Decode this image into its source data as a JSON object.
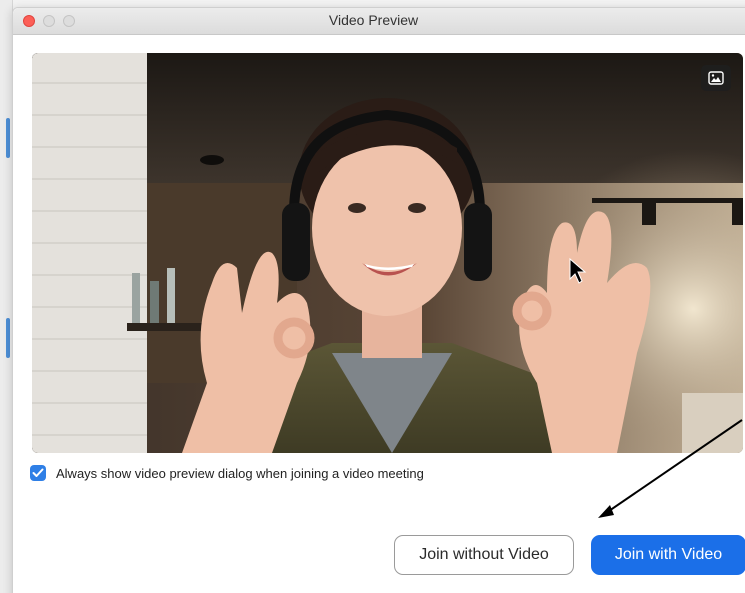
{
  "window": {
    "title": "Video Preview"
  },
  "video": {
    "icon": "picture-in-picture-icon",
    "content": "camera-preview"
  },
  "options": {
    "always_show_preview_label": "Always show video preview dialog when joining a video meeting",
    "always_show_preview_checked": true
  },
  "buttons": {
    "join_without_video": "Join without Video",
    "join_with_video": "Join with Video"
  },
  "colors": {
    "primary_button": "#1b6fe8",
    "checkbox": "#2f7fe6",
    "close_button": "#fc5f57"
  }
}
